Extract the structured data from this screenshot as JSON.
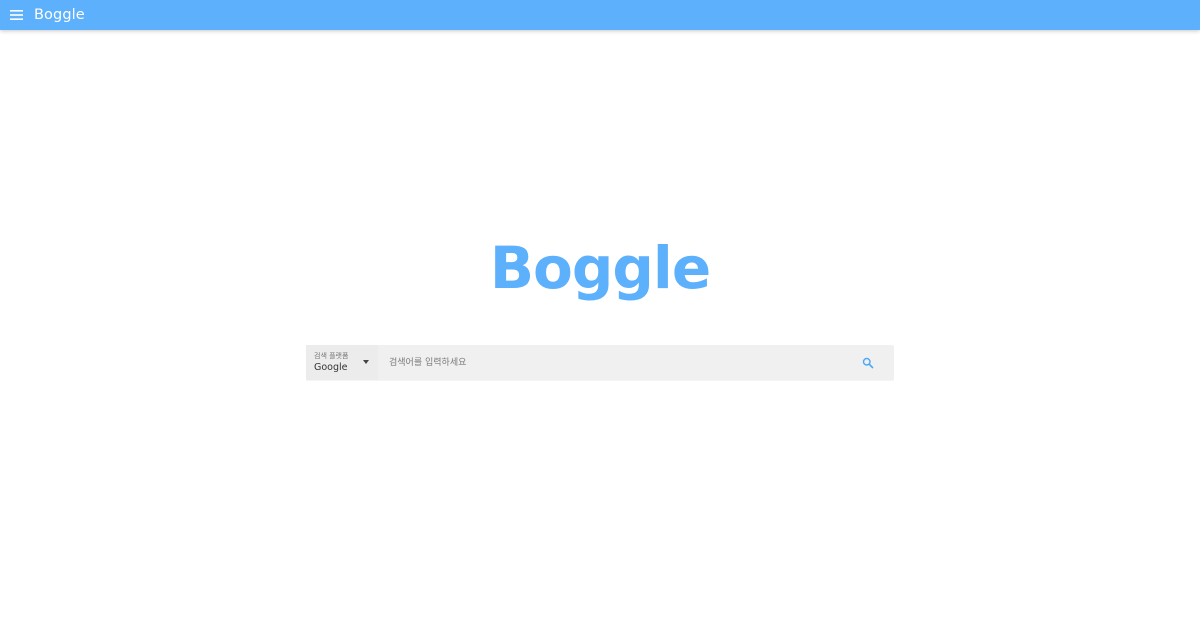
{
  "appbar": {
    "title": "Boggle",
    "menu_icon": "menu-icon",
    "color": "#5db0fc"
  },
  "main": {
    "logo_text": "Boggle",
    "logo_color": "#5db0fc"
  },
  "search": {
    "platform_caption": "검색 플랫폼",
    "platform_value": "Google",
    "placeholder": "검색어를 입력하세요",
    "value": "",
    "search_icon": "search-icon",
    "dropdown_icon": "caret-down-icon"
  }
}
